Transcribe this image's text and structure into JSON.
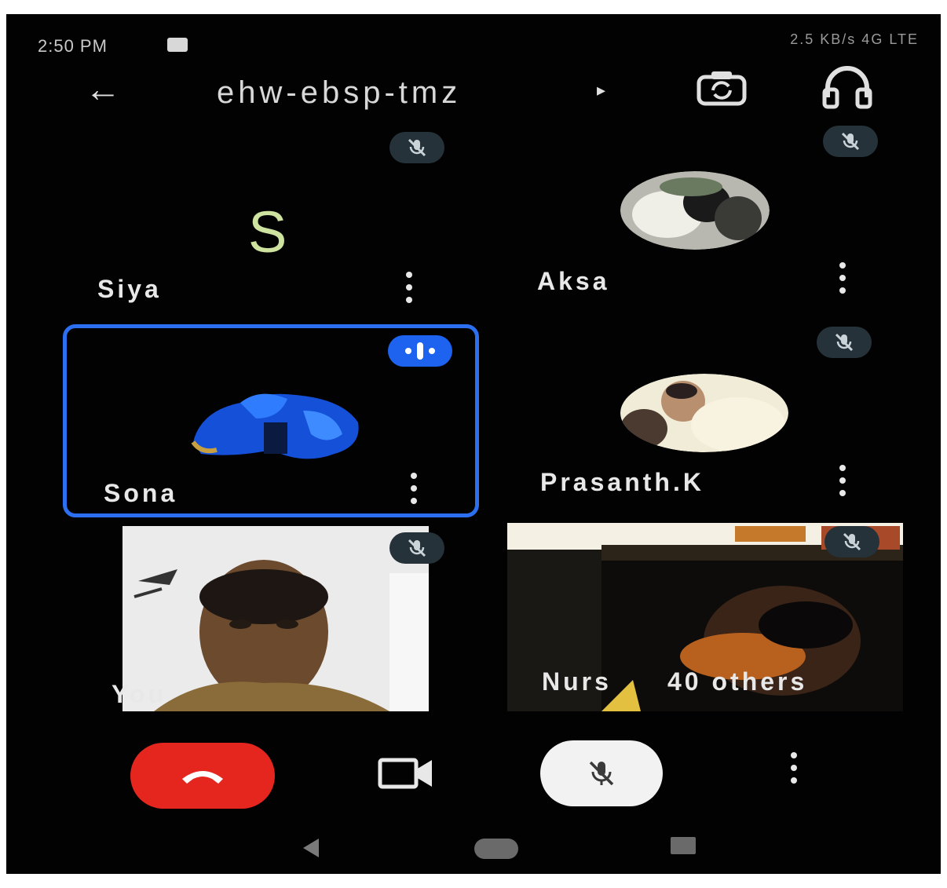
{
  "status_bar": {
    "time": "2:50 PM",
    "right": "2.5 KB/s  4G  LTE"
  },
  "header": {
    "back_icon": "arrow-left-icon",
    "meeting_code": "ehw-ebsp-tmz",
    "caret": "▸",
    "switch_camera_icon": "switch-camera-icon",
    "audio_icon": "headphones-icon"
  },
  "participants": [
    {
      "name": "Siya",
      "initial": "S",
      "muted": true,
      "state": "initial-avatar"
    },
    {
      "name": "Aksa",
      "muted": true,
      "state": "photo-avatar"
    },
    {
      "name": "Sona",
      "muted": false,
      "speaking": true,
      "state": "photo-avatar"
    },
    {
      "name": "Prasanth.K",
      "muted": true,
      "state": "photo-avatar"
    },
    {
      "name": "You",
      "muted": true,
      "state": "video"
    },
    {
      "name": "Nurs",
      "others": "40 others",
      "muted": true,
      "state": "video"
    }
  ],
  "controls": {
    "end_call_icon": "end-call-icon",
    "camera_icon": "video-camera-icon",
    "mic_icon": "mic-off-icon",
    "more_icon": "more-vertical-icon"
  },
  "colors": {
    "accent_blue": "#2c6ff0",
    "end_call_red": "#e5261f",
    "background": "#020202",
    "mute_badge": "#26323a"
  }
}
